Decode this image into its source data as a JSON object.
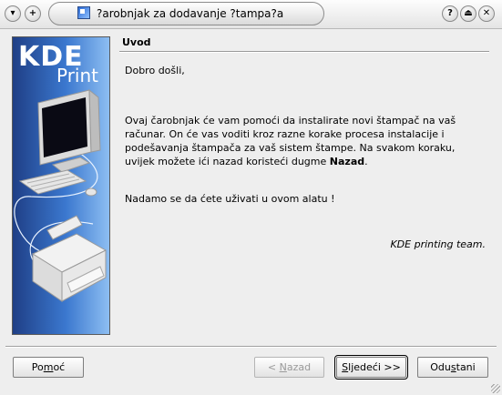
{
  "window": {
    "title": "?arobnjak za dodavanje ?tampa?a",
    "left_buttons": [
      "menu-arrow-icon",
      "sticky-plus-icon"
    ],
    "right_buttons": [
      "help-icon",
      "shade-icon",
      "close-icon"
    ]
  },
  "banner": {
    "logo_main": "KDE",
    "logo_sub": "Print"
  },
  "page": {
    "title": "Uvod",
    "welcome": "Dobro došli,",
    "body": "Ovaj čarobnjak će vam pomoći da instalirate novi štampač na vaš računar. On će vas voditi kroz razne korake procesa instalacije i podešavanja štampača za vaš sistem štampe. Na svakom koraku, uvijek možete ići nazad koristeći dugme",
    "body_bold": "Nazad",
    "body_end": ".",
    "hope": "Nadamo se da ćete uživati u ovom alatu !",
    "signature": "KDE printing team."
  },
  "buttons": {
    "help": {
      "before": "Po",
      "ul": "m",
      "after": "oć"
    },
    "back": {
      "before": "< ",
      "ul": "N",
      "after": "azad",
      "enabled": false
    },
    "next": {
      "before": "",
      "ul": "S",
      "after": "ljedeći >>",
      "default": true
    },
    "cancel": {
      "before": "Odu",
      "ul": "s",
      "after": "tani"
    }
  }
}
